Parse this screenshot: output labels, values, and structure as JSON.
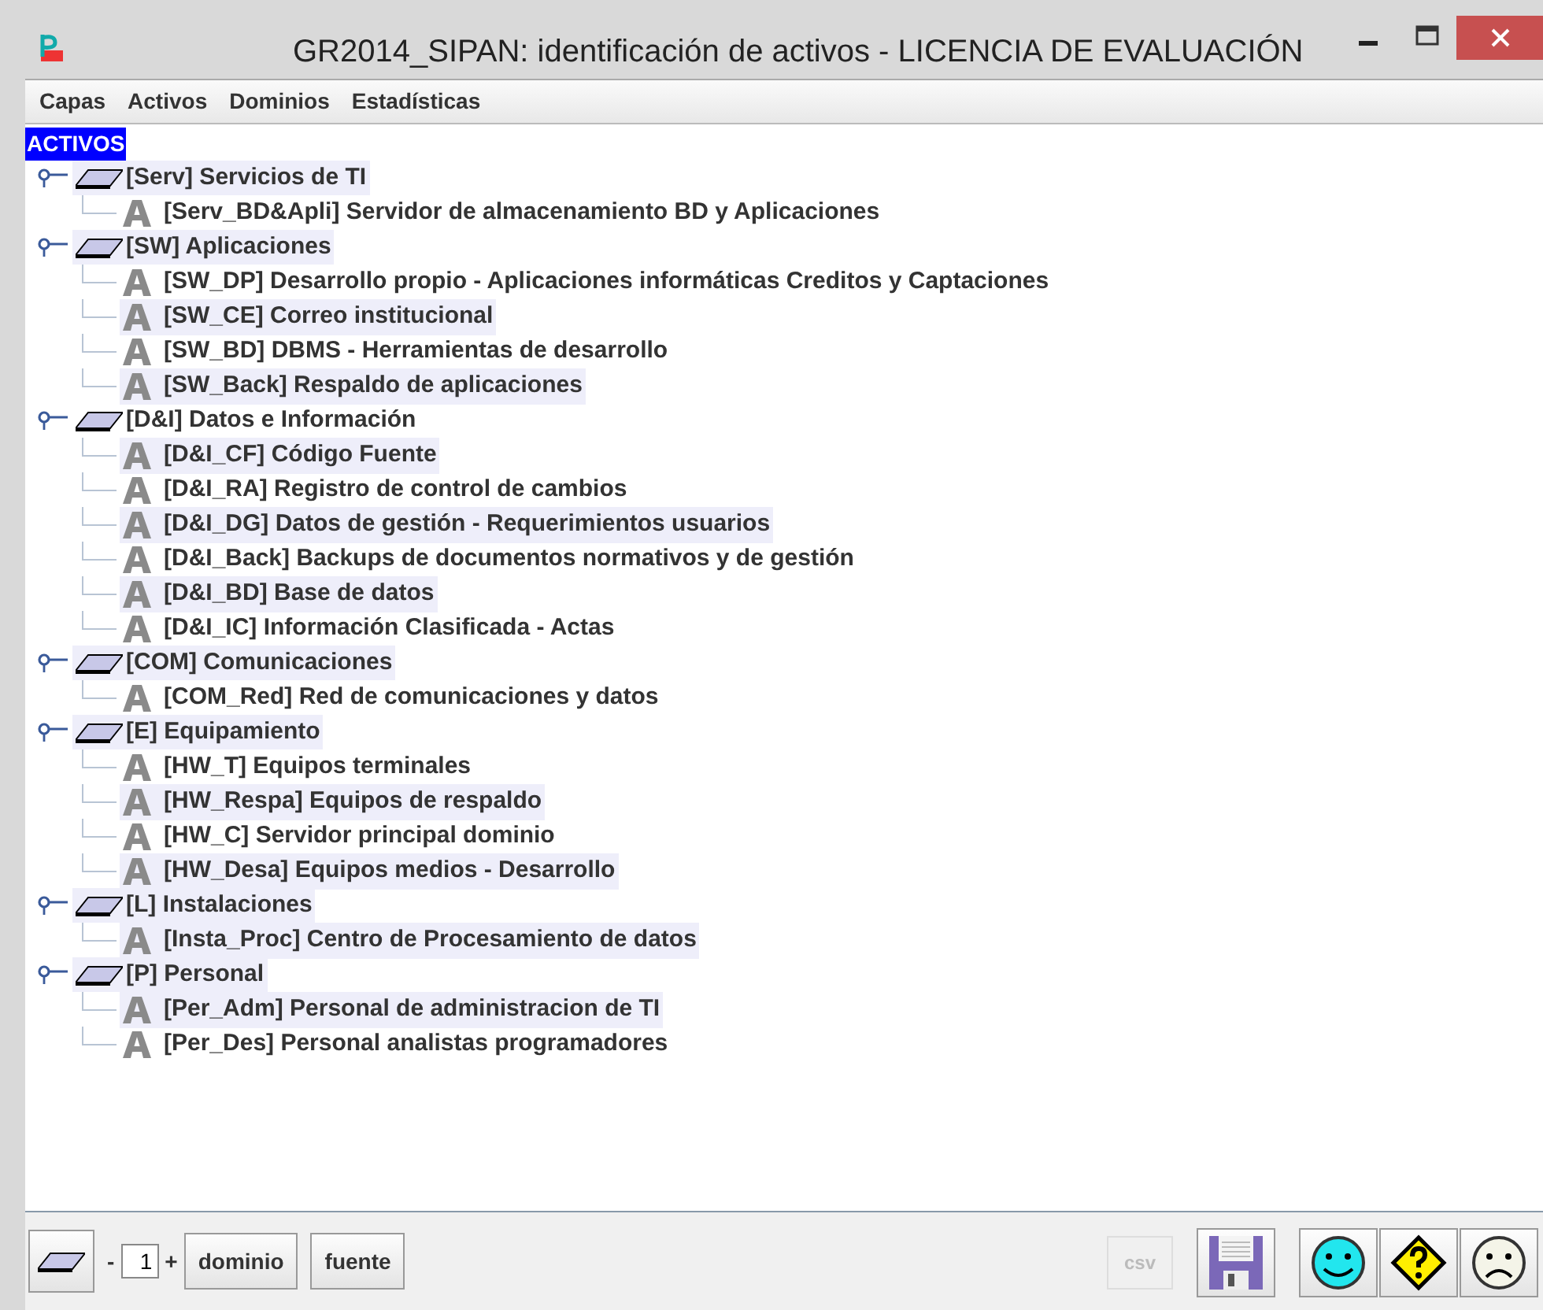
{
  "window": {
    "title": "GR2014_SIPAN: identificación de activos - LICENCIA DE EVALUACIÓN"
  },
  "menu": [
    "Capas",
    "Activos",
    "Dominios",
    "Estadísticas"
  ],
  "tree": {
    "root": {
      "label": "ACTIVOS",
      "selected": true
    },
    "groups": [
      {
        "label": "[Serv] Servicios de TI",
        "shaded": true,
        "expanded": true,
        "children": [
          {
            "label": "[Serv_BD&Apli] Servidor de almacenamiento BD y Aplicaciones",
            "shaded": false
          }
        ]
      },
      {
        "label": "[SW] Aplicaciones",
        "shaded": true,
        "expanded": true,
        "children": [
          {
            "label": "[SW_DP] Desarrollo propio - Aplicaciones informáticas Creditos y Captaciones",
            "shaded": false
          },
          {
            "label": "[SW_CE] Correo institucional",
            "shaded": true
          },
          {
            "label": "[SW_BD] DBMS - Herramientas de desarrollo",
            "shaded": false
          },
          {
            "label": "[SW_Back] Respaldo de aplicaciones",
            "shaded": true
          }
        ]
      },
      {
        "label": "[D&I] Datos e Información",
        "shaded": false,
        "expanded": true,
        "children": [
          {
            "label": "[D&I_CF] Código Fuente",
            "shaded": true
          },
          {
            "label": "[D&I_RA] Registro de control de cambios",
            "shaded": false
          },
          {
            "label": "[D&I_DG] Datos de gestión - Requerimientos usuarios",
            "shaded": true
          },
          {
            "label": "[D&I_Back] Backups de documentos normativos y de gestión",
            "shaded": false
          },
          {
            "label": "[D&I_BD] Base de datos",
            "shaded": true
          },
          {
            "label": "[D&I_IC] Información Clasificada - Actas",
            "shaded": false
          }
        ]
      },
      {
        "label": "[COM] Comunicaciones",
        "shaded": true,
        "expanded": true,
        "children": [
          {
            "label": "[COM_Red] Red de comunicaciones y datos",
            "shaded": false
          }
        ]
      },
      {
        "label": "[E] Equipamiento",
        "shaded": true,
        "expanded": true,
        "children": [
          {
            "label": "[HW_T] Equipos terminales",
            "shaded": false
          },
          {
            "label": "[HW_Respa] Equipos de respaldo",
            "shaded": true
          },
          {
            "label": "[HW_C] Servidor principal dominio",
            "shaded": false
          },
          {
            "label": "[HW_Desa] Equipos medios - Desarrollo",
            "shaded": true
          }
        ]
      },
      {
        "label": "[L] Instalaciones",
        "shaded": true,
        "expanded": true,
        "children": [
          {
            "label": "[Insta_Proc] Centro de Procesamiento de datos",
            "shaded": true
          }
        ]
      },
      {
        "label": "[P] Personal",
        "shaded": true,
        "expanded": true,
        "children": [
          {
            "label": "[Per_Adm] Personal de administracion de TI",
            "shaded": true
          },
          {
            "label": "[Per_Des] Personal analistas programadores",
            "shaded": false
          }
        ]
      }
    ]
  },
  "toolbar": {
    "minus": "-",
    "level": "1",
    "plus": "+",
    "buttons": [
      "dominio",
      "fuente"
    ],
    "csv": {
      "label": "csv",
      "disabled": true
    }
  }
}
